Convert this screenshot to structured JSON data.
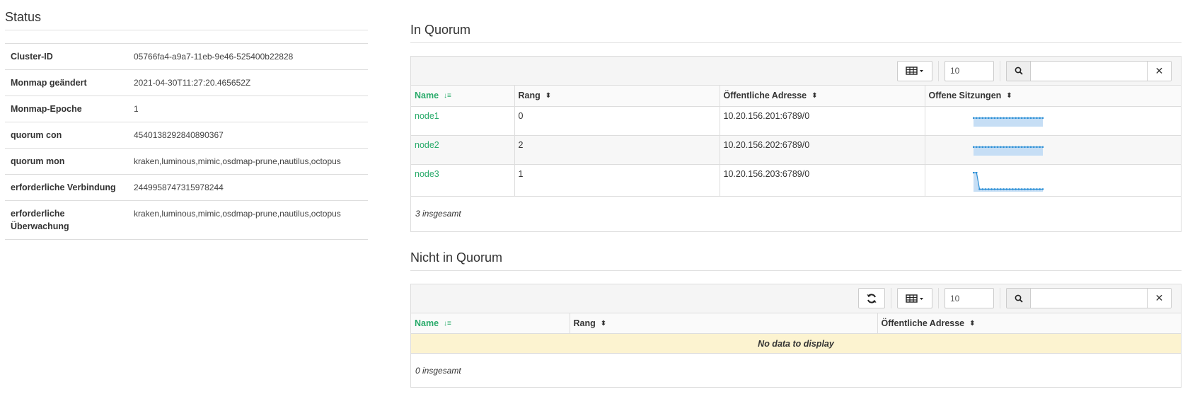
{
  "status": {
    "title": "Status",
    "rows": [
      {
        "key": "Cluster-ID",
        "value": "05766fa4-a9a7-11eb-9e46-525400b22828"
      },
      {
        "key": "Monmap geändert",
        "value": "2021-04-30T11:27:20.465652Z"
      },
      {
        "key": "Monmap-Epoche",
        "value": "1"
      },
      {
        "key": "quorum con",
        "value": "4540138292840890367"
      },
      {
        "key": "quorum mon",
        "value": "kraken,luminous,mimic,osdmap-prune,nautilus,octopus"
      },
      {
        "key": "erforderliche Verbindung",
        "value": "2449958747315978244"
      },
      {
        "key": "erforderliche Überwachung",
        "value": "kraken,luminous,mimic,osdmap-prune,nautilus,octopus"
      }
    ]
  },
  "in_quorum": {
    "title": "In Quorum",
    "limit": "10",
    "search_placeholder": "",
    "columns": {
      "name": "Name",
      "rank": "Rang",
      "address": "Öffentliche Adresse",
      "sessions": "Offene Sitzungen"
    },
    "rows": [
      {
        "name": "node1",
        "rank": "0",
        "address": "10.20.156.201:6789/0",
        "sessions": [
          7,
          7,
          7,
          7,
          7,
          7,
          7,
          7,
          7,
          7,
          7,
          7,
          7,
          7,
          7,
          7,
          7,
          7,
          7,
          7,
          7,
          7,
          7,
          7
        ]
      },
      {
        "name": "node2",
        "rank": "2",
        "address": "10.20.156.202:6789/0",
        "sessions": [
          7,
          7,
          7,
          7,
          7,
          7,
          7,
          7,
          7,
          7,
          7,
          7,
          7,
          7,
          7,
          7,
          7,
          7,
          7,
          7,
          7,
          7,
          7,
          7
        ]
      },
      {
        "name": "node3",
        "rank": "1",
        "address": "10.20.156.203:6789/0",
        "sessions": [
          10,
          10,
          1,
          1,
          1,
          1,
          1,
          1,
          1,
          1,
          1,
          1,
          1,
          1,
          1,
          1,
          1,
          1,
          1,
          1,
          1,
          1,
          1,
          1
        ]
      }
    ],
    "total": "3 insgesamt"
  },
  "not_in_quorum": {
    "title": "Nicht in Quorum",
    "limit": "10",
    "search_placeholder": "",
    "columns": {
      "name": "Name",
      "rank": "Rang",
      "address": "Öffentliche Adresse"
    },
    "empty_text": "No data to display",
    "total": "0 insgesamt"
  },
  "colors": {
    "accent": "#2aab6b",
    "spark_line": "#2b8fd6",
    "spark_fill": "#c6def5",
    "empty_bg": "#fcf3d0"
  }
}
